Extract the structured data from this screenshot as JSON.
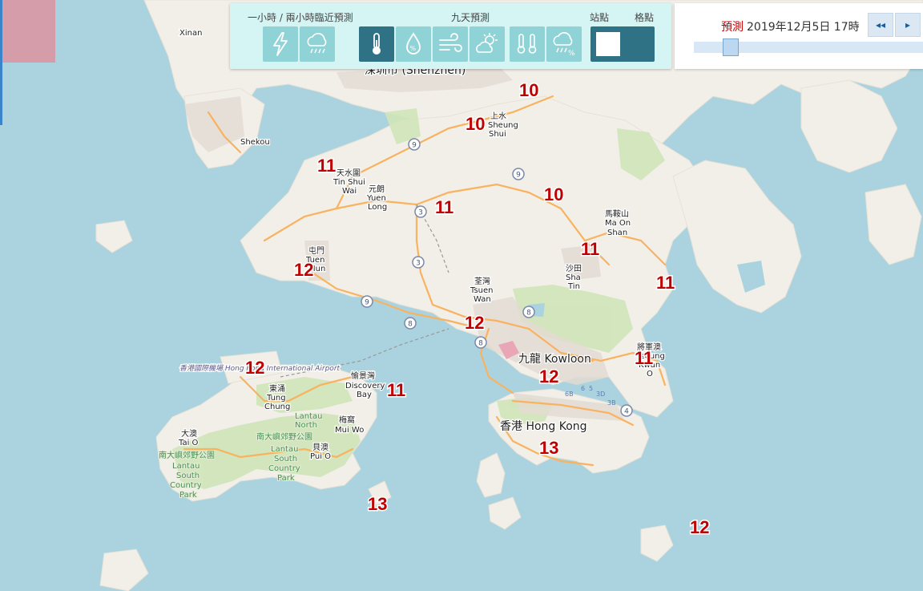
{
  "toolbar": {
    "group1_label": "一小時 / 兩小時臨近預測",
    "group2_label": "九天預測",
    "group3_label_a": "站點",
    "group3_label_b": "格點",
    "buttons": [
      {
        "icon": "lightning-icon",
        "active": false
      },
      {
        "icon": "rain-cloud-icon",
        "active": false
      },
      {
        "icon": "thermometer-icon",
        "active": true
      },
      {
        "icon": "humidity-drop-icon",
        "active": false
      },
      {
        "icon": "wind-icon",
        "active": false
      },
      {
        "icon": "sun-cloud-icon",
        "active": false
      },
      {
        "icon": "temperature-range-icon",
        "active": false
      },
      {
        "icon": "rain-probability-icon",
        "active": false
      }
    ],
    "colors": {
      "panel": "#d5f5f5",
      "button": "#8fd3d6",
      "active": "#2f7286"
    }
  },
  "time_panel": {
    "label": "預測",
    "datetime": "2019年12月5日 17時",
    "prev_button": "◂◂",
    "next_button": "▸"
  },
  "map": {
    "temperature_color": "#c00000",
    "temperatures": [
      {
        "id": "t1",
        "value": "10"
      },
      {
        "id": "t2",
        "value": "10"
      },
      {
        "id": "t3",
        "value": "11"
      },
      {
        "id": "t4",
        "value": "10"
      },
      {
        "id": "t5",
        "value": "11"
      },
      {
        "id": "t6",
        "value": "11"
      },
      {
        "id": "t7",
        "value": "12"
      },
      {
        "id": "t8",
        "value": "11"
      },
      {
        "id": "t9",
        "value": "12"
      },
      {
        "id": "t10",
        "value": "12"
      },
      {
        "id": "t11",
        "value": "11"
      },
      {
        "id": "t12",
        "value": "11"
      },
      {
        "id": "t13",
        "value": "12"
      },
      {
        "id": "t14",
        "value": "13"
      },
      {
        "id": "t15",
        "value": "13"
      },
      {
        "id": "t16",
        "value": "12"
      }
    ],
    "places": {
      "xinan": "Xinan",
      "shenzhen": "深圳市 (Shenzhen)",
      "sheung_shui_a": "上水",
      "sheung_shui_b": "Sheung",
      "sheung_shui_c": "Shui",
      "shekou": "Shekou",
      "tin_shui_wai_a": "天水圍",
      "tin_shui_wai_b": "Tin Shui",
      "tin_shui_wai_c": "Wai",
      "yuen_long_a": "元朗",
      "yuen_long_b": "Yuen",
      "yuen_long_c": "Long",
      "ma_on_shan_a": "馬鞍山",
      "ma_on_shan_b": "Ma On",
      "ma_on_shan_c": "Shan",
      "tuen_mun_a": "屯門",
      "tuen_mun_b": "Tuen",
      "tuen_mun_c": "Mun",
      "sha_tin_a": "沙田",
      "sha_tin_b": "Sha",
      "sha_tin_c": "Tin",
      "tsuen_wan_a": "荃灣",
      "tsuen_wan_b": "Tsuen",
      "tsuen_wan_c": "Wan",
      "kowloon": "九龍 Kowloon",
      "tseung_kwan_o_a": "將軍澳",
      "tseung_kwan_o_b": "Tseung",
      "tseung_kwan_o_c": "Kwan",
      "tseung_kwan_o_d": "O",
      "airport": "香港國際機場 Hong Kong International Airport",
      "tung_chung_a": "東涌",
      "tung_chung_b": "Tung",
      "tung_chung_c": "Chung",
      "discovery_bay_a": "愉景灣",
      "discovery_bay_b": "Discovery",
      "discovery_bay_c": "Bay",
      "lantau_north_a": "Lantau",
      "lantau_north_b": "North",
      "lantau_north_c": "南大嶼郊野公園",
      "hong_kong": "香港 Hong Kong",
      "mui_wo_a": "梅窩",
      "mui_wo_b": "Mui Wo",
      "tai_o_a": "大澳",
      "tai_o_b": "Tai O",
      "pui_o_a": "貝澳",
      "pui_o_b": "Pui O",
      "lantau_south_a": "南大嶼郊野公園",
      "lantau_south_b": "Lantau",
      "lantau_south_c": "South",
      "lantau_south_d": "Country",
      "lantau_south_e": "Park",
      "lantau_south2_a": "Lantau",
      "lantau_south2_b": "South",
      "lantau_south2_c": "Country",
      "lantau_south2_d": "Park"
    },
    "route_shields": [
      "9",
      "9",
      "3",
      "3",
      "9",
      "8",
      "8",
      "8",
      "4"
    ],
    "highway_labels": [
      "6B",
      "6",
      "5",
      "3D",
      "3B"
    ]
  }
}
